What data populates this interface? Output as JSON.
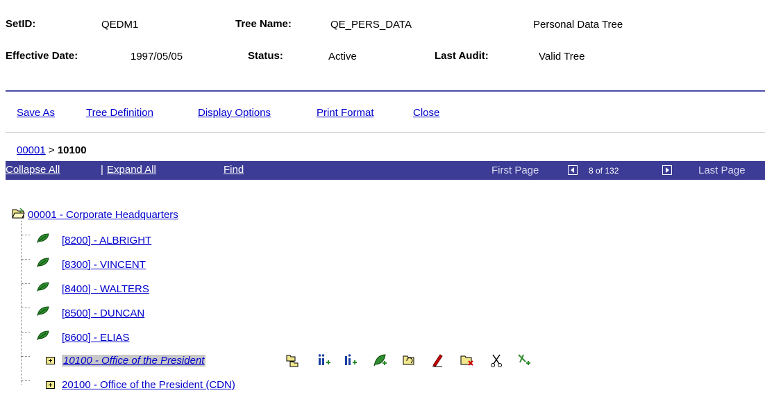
{
  "header": {
    "setid_label": "SetID:",
    "setid_value": "QEDM1",
    "tree_name_label": "Tree Name:",
    "tree_name_value": "QE_PERS_DATA",
    "tree_description": "Personal Data Tree",
    "effective_date_label": "Effective Date:",
    "effective_date_value": "1997/05/05",
    "status_label": "Status:",
    "status_value": "Active",
    "last_audit_label": "Last Audit:",
    "last_audit_value": "Valid Tree"
  },
  "menu": {
    "save_as": "Save As",
    "tree_definition": "Tree Definition",
    "display_options": "Display Options",
    "print_format": "Print Format",
    "close": "Close"
  },
  "breadcrumb": {
    "root": "00001",
    "separator": ">",
    "current": "10100"
  },
  "navbar": {
    "collapse_all": "Collapse All",
    "divider": "|",
    "expand_all": "Expand All",
    "find": "Find",
    "first_page": "First Page",
    "page_info": "8 of 132",
    "last_page": "Last Page"
  },
  "tree": {
    "root": "00001 - Corporate Headquarters",
    "leaves": [
      "[8200] - ALBRIGHT",
      "[8300] - VINCENT",
      "[8400] - WALTERS",
      "[8500] - DUNCAN",
      "[8600] - ELIAS"
    ],
    "nodes": [
      "10100 - Office of the President",
      "20100 - Office of the President (CDN)"
    ]
  },
  "colors": {
    "navbar_bg": "#3c3c96",
    "link": "#0000cc",
    "rule": "#4a4aa8",
    "leaf_green": "#2e8b2e",
    "selection_grey": "#c8c8c8"
  },
  "toolbar_icons": [
    "insert-sibling-icon",
    "insert-child-detail-icon",
    "insert-sibling-detail-icon",
    "insert-leaf-icon",
    "move-node-icon",
    "edit-data-icon",
    "delete-node-icon",
    "cut-icon",
    "insert-child-icon"
  ]
}
